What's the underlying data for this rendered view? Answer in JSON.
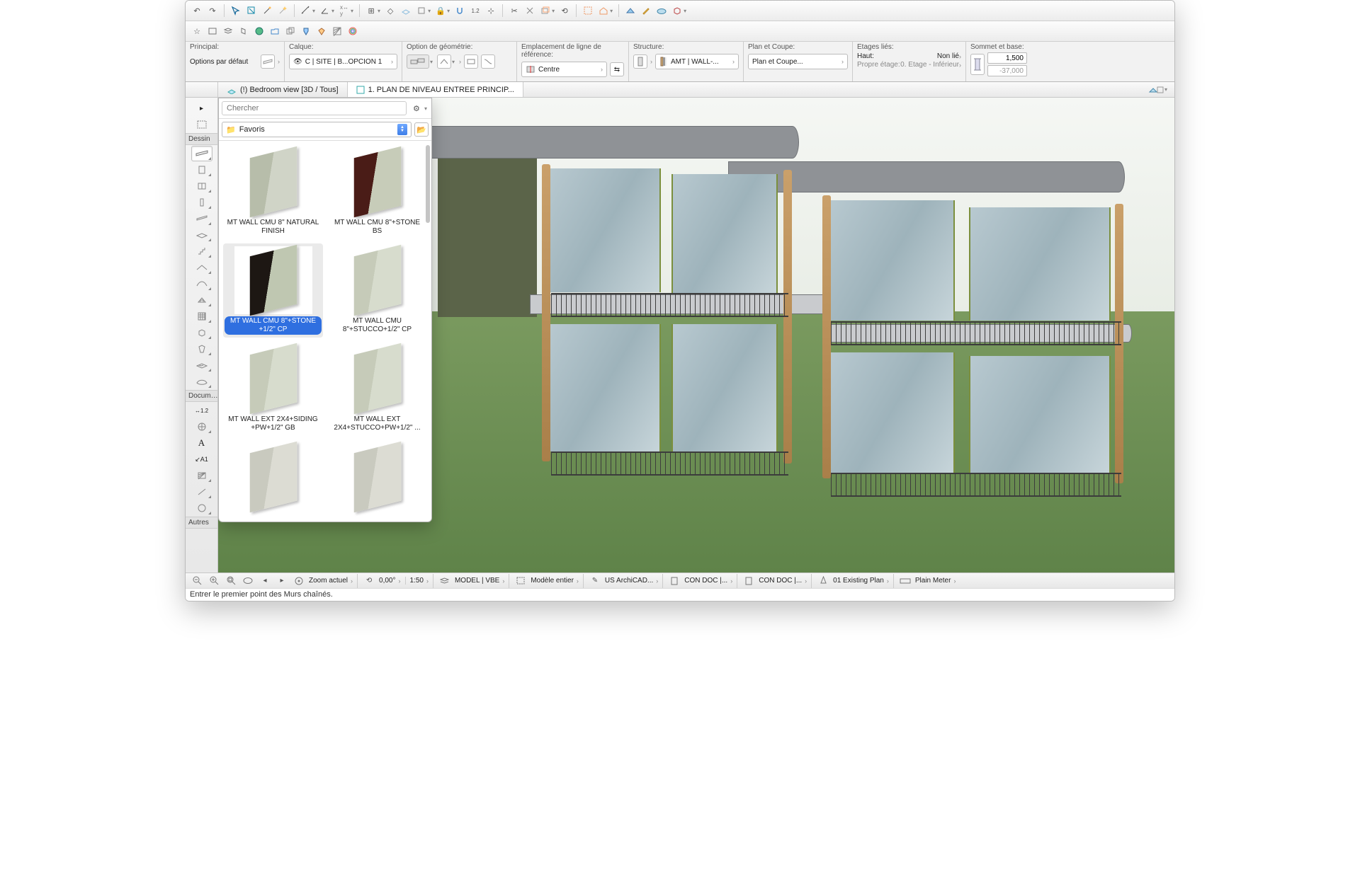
{
  "infobox": {
    "principal": {
      "label": "Principal:",
      "value": "Options par défaut"
    },
    "calque": {
      "label": "Calque:",
      "value": "C | SITE | B...OPCION 1"
    },
    "geom": {
      "label": "Option de géométrie:"
    },
    "refline": {
      "label": "Emplacement de ligne de référence:",
      "value": "Centre"
    },
    "structure": {
      "label": "Structure:",
      "value": "AMT | WALL-..."
    },
    "plan": {
      "label": "Plan et Coupe:",
      "value": "Plan et Coupe..."
    },
    "etages": {
      "label": "Etages liés:",
      "haut": "Haut:",
      "haut_val": "Non lié",
      "propre": "Propre étage:",
      "propre_val": "0. Etage - Inférieur"
    },
    "sommet": {
      "label": "Sommet et base:",
      "top": "1,500",
      "bot": "-37,000"
    }
  },
  "tabs": {
    "tab1": "(!) Bedroom view [3D / Tous]",
    "tab2": "1. PLAN DE NIVEAU ENTREE PRINCIP..."
  },
  "toolgroups": {
    "dessin": "Dessin",
    "document": "Docum…",
    "autres": "Autres"
  },
  "fav": {
    "search_placeholder": "Chercher",
    "folder": "Favoris",
    "items": [
      {
        "name": "MT WALL CMU 8\" NATURAL FINISH",
        "c1": "#b7bdaa",
        "c2": "#d0d4c7"
      },
      {
        "name": "MT WALL CMU 8\"+STONE BS",
        "c1": "#4a1c17",
        "c2": "#c7ccb9"
      },
      {
        "name": "MT WALL CMU 8\"+STONE +1/2\" CP",
        "c1": "#1d1713",
        "c2": "#bfc7b1"
      },
      {
        "name": "MT WALL CMU 8\"+STUCCO+1/2\" CP",
        "c1": "#c6cbb9",
        "c2": "#d7dccd"
      },
      {
        "name": "MT WALL EXT 2X4+SIDING +PW+1/2\" GB",
        "c1": "#c6cbb9",
        "c2": "#d7dccd"
      },
      {
        "name": "MT WALL EXT 2X4+STUCCO+PW+1/2\" ...",
        "c1": "#c6cbb9",
        "c2": "#d7dccd"
      },
      {
        "name": "",
        "c1": "#c9cabf",
        "c2": "#dcdcd3"
      },
      {
        "name": "",
        "c1": "#c9cabf",
        "c2": "#dcdcd3"
      }
    ],
    "selected_index": 2
  },
  "status": {
    "zoom": "Zoom actuel",
    "angle": "0,00°",
    "scale": "1:50",
    "model": "MODEL | VBE",
    "modele": "Modèle entier",
    "layers": "US ArchiCAD...",
    "condoc1": "CON DOC |...",
    "condoc2": "CON DOC |...",
    "plan": "01 Existing Plan",
    "meter": "Plain Meter"
  },
  "prompt": "Entrer le premier point des Murs chaînés."
}
